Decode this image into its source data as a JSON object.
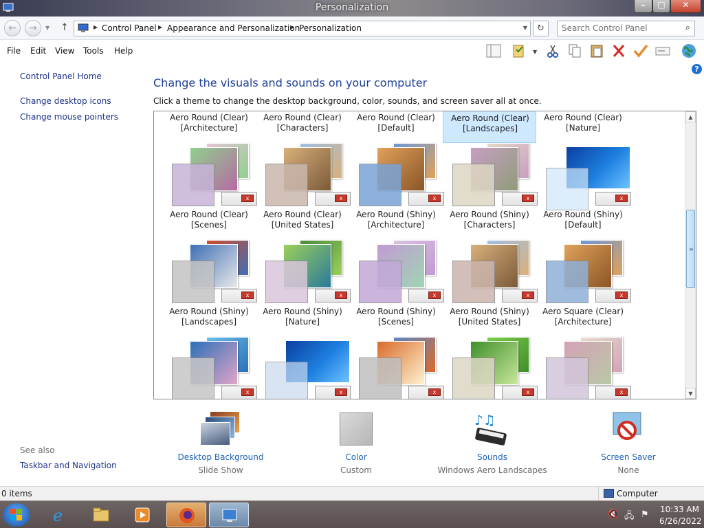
{
  "window": {
    "title": "Personalization",
    "min_icon": "minimize-icon",
    "max_icon": "maximize-icon",
    "close_icon": "close-icon",
    "min_glyph": "–",
    "max_glyph": "□",
    "close_glyph": "✕"
  },
  "address": {
    "crumbs": [
      "Control Panel",
      "Appearance and Personalization",
      "Personalization"
    ],
    "search_placeholder": "Search Control Panel"
  },
  "menu": [
    "File",
    "Edit",
    "View",
    "Tools",
    "Help"
  ],
  "left_pane": {
    "links": [
      "Control Panel Home",
      "Change desktop icons",
      "Change mouse pointers"
    ],
    "see_also_heading": "See also",
    "see_also_links": [
      "Taskbar and Navigation"
    ]
  },
  "main": {
    "heading": "Change the visuals and sounds on your computer",
    "description": "Click a theme to change the desktop background, color, sounds, and screen saver all at once.",
    "themes": [
      {
        "line1": "Aero Round (Clear)",
        "line2": "[Architecture]"
      },
      {
        "line1": "Aero Round (Clear)",
        "line2": "[Characters]"
      },
      {
        "line1": "Aero Round (Clear)",
        "line2": "[Default]"
      },
      {
        "line1": "Aero Round (Clear)",
        "line2": "[Landscapes]",
        "selected": true
      },
      {
        "line1": "Aero Round (Clear)",
        "line2": "[Nature]"
      },
      {
        "line1": "Aero Round (Clear)",
        "line2": "[Scenes]"
      },
      {
        "line1": "Aero Round (Clear)",
        "line2": "[United States]"
      },
      {
        "line1": "Aero Round (Shiny)",
        "line2": "[Architecture]"
      },
      {
        "line1": "Aero Round (Shiny)",
        "line2": "[Characters]"
      },
      {
        "line1": "Aero Round (Shiny)",
        "line2": "[Default]"
      },
      {
        "line1": "Aero Round (Shiny)",
        "line2": "[Landscapes]"
      },
      {
        "line1": "Aero Round (Shiny)",
        "line2": "[Nature]"
      },
      {
        "line1": "Aero Round (Shiny)",
        "line2": "[Scenes]"
      },
      {
        "line1": "Aero Round (Shiny)",
        "line2": "[United States]"
      },
      {
        "line1": "Aero Square (Clear)",
        "line2": "[Architecture]"
      }
    ]
  },
  "settings": [
    {
      "label": "Desktop Background",
      "value": "Slide Show",
      "icon": "desktop-background-icon"
    },
    {
      "label": "Color",
      "value": "Custom",
      "icon": "color-swatch-icon"
    },
    {
      "label": "Sounds",
      "value": "Windows Aero Landscapes",
      "icon": "sounds-icon"
    },
    {
      "label": "Screen Saver",
      "value": "None",
      "icon": "screen-saver-icon"
    }
  ],
  "status": {
    "items": "0 items",
    "location": "Computer"
  },
  "taskbar": {
    "time": "10:33 AM",
    "date": "6/26/2022"
  },
  "colors": {
    "link": "#1e3287",
    "heading": "#1e3f97",
    "selection": "#cde8ff"
  }
}
